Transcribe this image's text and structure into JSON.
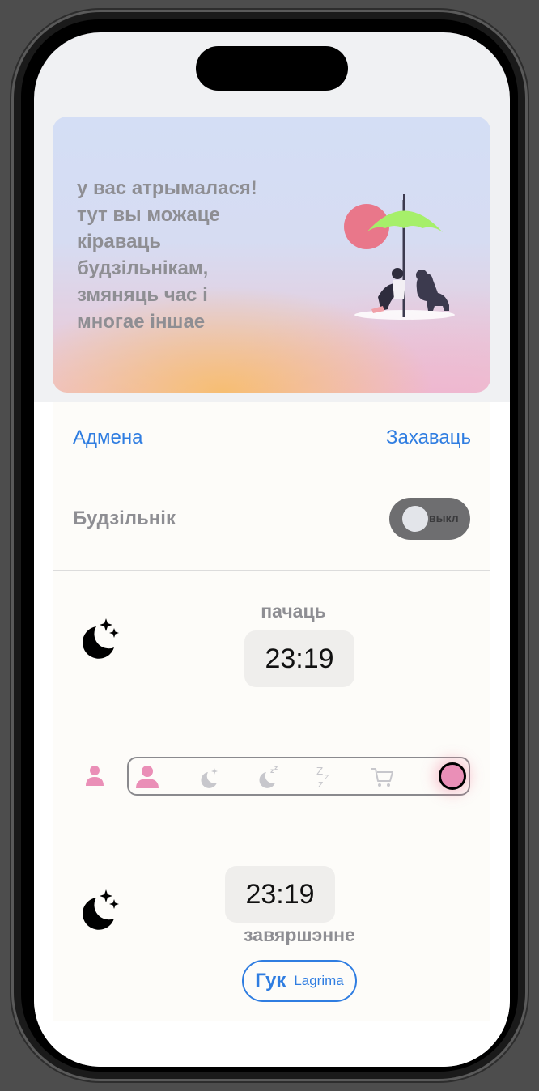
{
  "banner": {
    "lines": [
      "у вас атрымалася!",
      "тут вы можаце",
      "кіраваць",
      "будзільнікам,",
      "змяняць час і",
      "многае іншае"
    ]
  },
  "nav": {
    "cancel_label": "Адмена",
    "save_label": "Захаваць"
  },
  "alarm": {
    "label": "Будзільнік",
    "toggle_state": "выкл"
  },
  "schedule": {
    "start_label": "пачаць",
    "start_time": "23:19",
    "end_time": "23:19",
    "end_label": "завяршэнне"
  },
  "modes": {
    "icons": [
      "person-icon",
      "moon-stars-icon",
      "moon-zz-icon",
      "zzz-icon",
      "cart-icon"
    ],
    "indicator_color": "#ea8fb7"
  },
  "sound": {
    "key": "Гук",
    "value": "Lagrima"
  },
  "colors": {
    "accent": "#2f7de1",
    "pink": "#ea8fb7",
    "muted_text": "#8e8e93"
  }
}
